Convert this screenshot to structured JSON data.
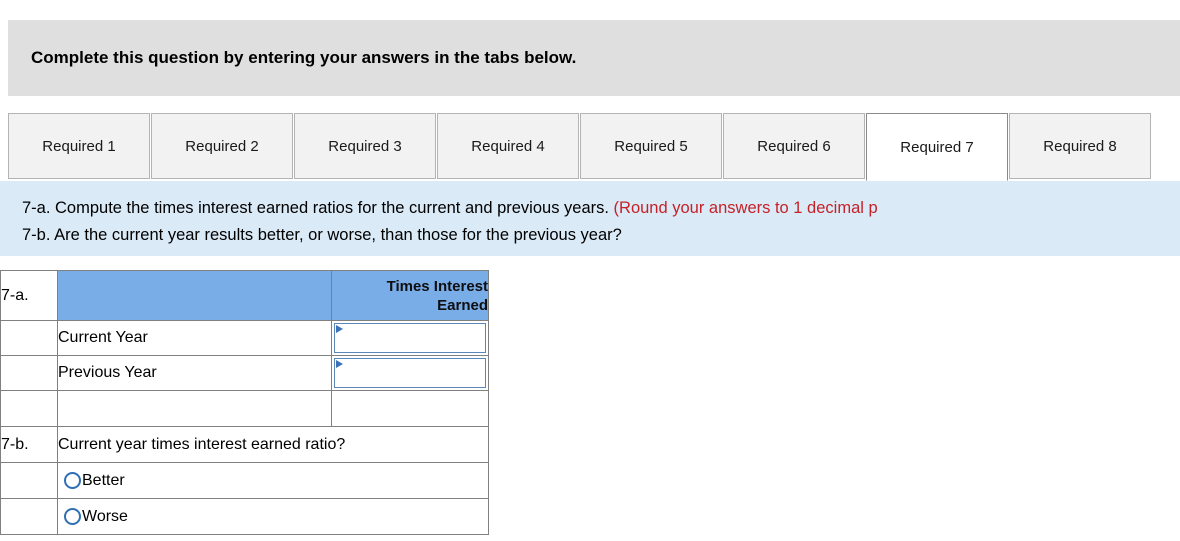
{
  "banner": {
    "text": "Complete this question by entering your answers in the tabs below."
  },
  "tabs": {
    "items": [
      {
        "label": "Required 1",
        "active": false
      },
      {
        "label": "Required 2",
        "active": false
      },
      {
        "label": "Required 3",
        "active": false
      },
      {
        "label": "Required 4",
        "active": false
      },
      {
        "label": "Required 5",
        "active": false
      },
      {
        "label": "Required 6",
        "active": false
      },
      {
        "label": "Required 7",
        "active": true
      },
      {
        "label": "Required 8",
        "active": false
      }
    ]
  },
  "requirement": {
    "line_a_black": "7-a. Compute the times interest earned ratios for the current and previous years. ",
    "line_a_red": "(Round your answers to 1 decimal p",
    "line_b": "7-b. Are the current year results better, or worse, than those for the previous year?"
  },
  "table": {
    "section_a_label": "7-a.",
    "section_b_label": "7-b.",
    "column_header": "Times Interest Earned",
    "rows": [
      {
        "label": "",
        "desc": "Current Year",
        "value": ""
      },
      {
        "label": "",
        "desc": "Previous Year",
        "value": ""
      }
    ],
    "question_b": "Current year times interest earned ratio?",
    "options": [
      {
        "label": "Better",
        "selected": false
      },
      {
        "label": "Worse",
        "selected": false
      }
    ]
  },
  "colors": {
    "banner_gray": "#dfdfdf",
    "band_blue": "#daeaf7",
    "header_blue": "#79ade8",
    "red_text": "#c62127",
    "radio_blue": "#2f6fb5",
    "border_gray": "#808080"
  }
}
